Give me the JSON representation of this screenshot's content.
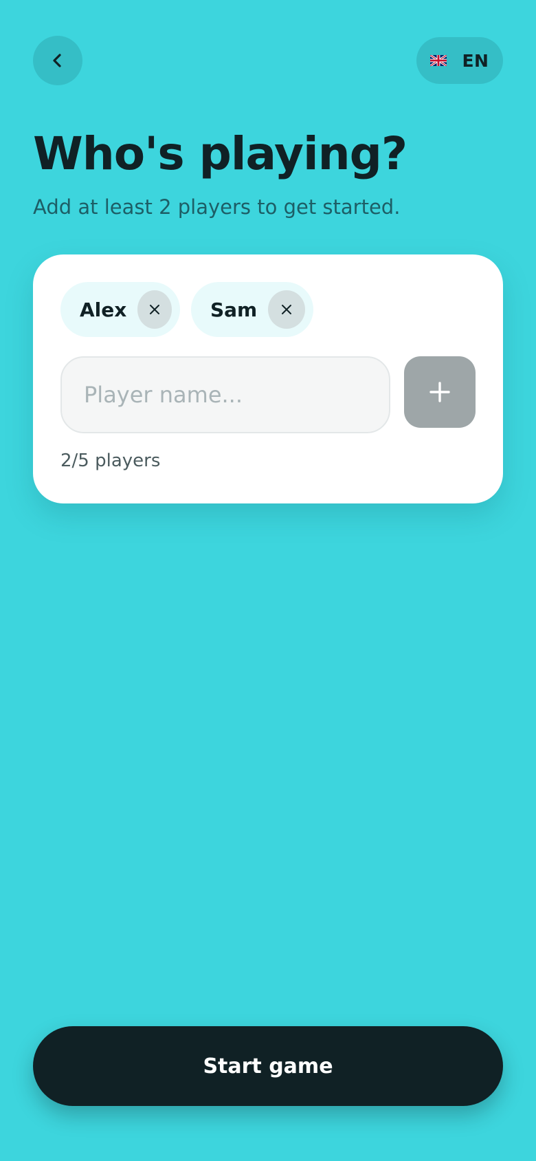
{
  "header": {
    "back_icon": "chevron-left-icon",
    "language": {
      "flag_icon": "uk-flag-icon",
      "code": "EN"
    }
  },
  "title": "Who's playing?",
  "subtitle": "Add at least 2 players to get started.",
  "players": [
    {
      "name": "Alex",
      "remove_icon": "close-icon"
    },
    {
      "name": "Sam",
      "remove_icon": "close-icon"
    }
  ],
  "input": {
    "placeholder": "Player name...",
    "value": ""
  },
  "add_button_icon": "plus-icon",
  "player_count": "2/5 players",
  "start_button": "Start game",
  "colors": {
    "background": "#3dd5dd",
    "primary_dark": "#102125",
    "card": "#ffffff",
    "chip": "#e8fafb",
    "add_button_disabled": "#9ea6a8"
  }
}
